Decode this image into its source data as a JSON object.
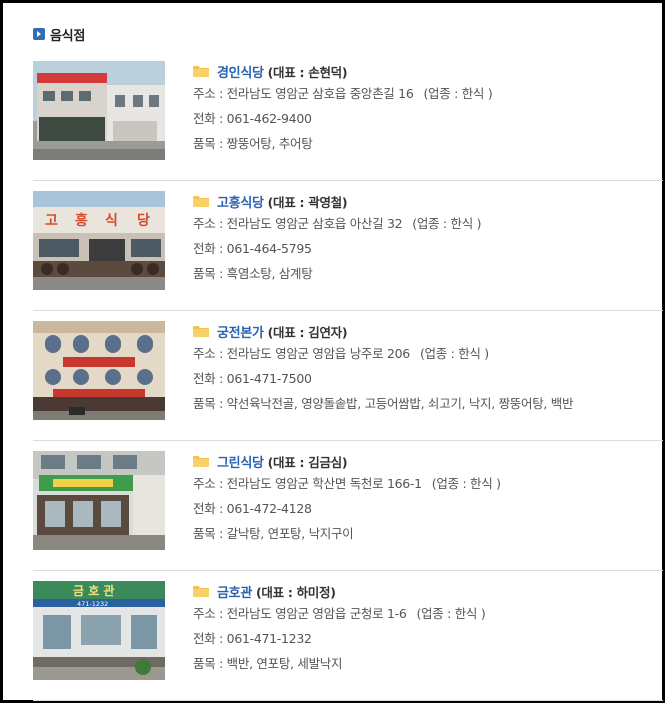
{
  "section": {
    "title": "음식점",
    "icon": "arrow-icon"
  },
  "labels": {
    "address": "주소 : ",
    "category_prefix": "(업종 : ",
    "category_suffix": " )",
    "phone": "전화 : ",
    "menu": "품목 : ",
    "rep_prefix": "(대표 : ",
    "rep_suffix": ")"
  },
  "restaurants": [
    {
      "name": "경인식당",
      "rep": "손현덕",
      "address": "전라남도 영암군 삼호읍 중앙촌길 16",
      "category": "한식",
      "phone": "061-462-9400",
      "menu": "짱뚱어탕, 추어탕"
    },
    {
      "name": "고흥식당",
      "rep": "곽영철",
      "address": "전라남도 영암군 삼호읍 아산길 32",
      "category": "한식",
      "phone": "061-464-5795",
      "menu": "흑염소탕, 삼계탕"
    },
    {
      "name": "궁전본가",
      "rep": "김연자",
      "address": "전라남도 영암군 영암읍 낭주로 206",
      "category": "한식",
      "phone": "061-471-7500",
      "menu": "약선육낙전골, 영양돌솥밥, 고등어쌈밥, 쇠고기, 낙지, 짱뚱어탕, 백반"
    },
    {
      "name": "그린식당",
      "rep": "김금심",
      "address": "전라남도 영암군 학산면 독천로 166-1",
      "category": "한식",
      "phone": "061-472-4128",
      "menu": "갈낙탕, 연포탕, 낙지구이"
    },
    {
      "name": "금호관",
      "rep": "하미정",
      "address": "전라남도 영암군 영암읍 군청로 1-6",
      "category": "한식",
      "phone": "061-471-1232",
      "menu": "백반, 연포탕, 세발낙지"
    }
  ],
  "photo_signs": {
    "gohung": [
      "고",
      "흥",
      "식",
      "당"
    ],
    "geumho_sign": "금 호 관",
    "geumho_phone": "471-1232"
  },
  "colors": {
    "link": "#2862b3",
    "section_icon": "#2f6db5",
    "folder": "#f2c14e"
  }
}
